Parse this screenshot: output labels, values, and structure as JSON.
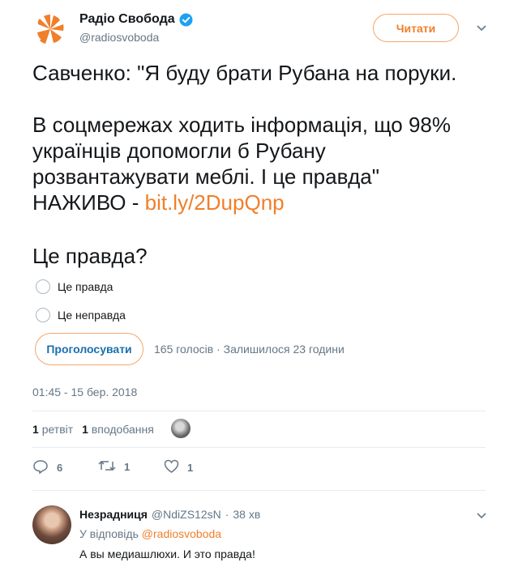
{
  "account": {
    "display_name": "Радіо Свобода",
    "handle": "@radiosvoboda",
    "follow_label": "Читати",
    "brand_color": "#f07f2a",
    "verified_color": "#1da1f2"
  },
  "tweet": {
    "line1": "Савченко: \"Я буду брати Рубана на поруки.",
    "line2": "В соцмережах ходить інформація, що 98%",
    "line3": "українців допомогли б Рубану",
    "line4": "розвантажувати меблі. І це правда\"",
    "line5_prefix": "НАЖИВО - ",
    "link": "bit.ly/2DupQnp"
  },
  "poll": {
    "question": "Це правда?",
    "options": [
      "Це правда",
      "Це неправда"
    ],
    "vote_label": "Проголосувати",
    "meta": "165 голосів · Залишилося 23 години"
  },
  "timestamp": "01:45 - 15 бер. 2018",
  "stats": {
    "retweets_count": "1",
    "retweets_label": "ретвіт",
    "likes_count": "1",
    "likes_label": "вподобання"
  },
  "actions": {
    "reply_count": "6",
    "retweet_count": "1",
    "like_count": "1"
  },
  "reply": {
    "name": "Незрадниця",
    "handle": "@NdiZS12sN",
    "separator": "·",
    "time": "38 хв",
    "reply_to_prefix": "У відповідь",
    "reply_to_mention": "@radiosvoboda",
    "text": "А вы медиашлюхи. И это правда!"
  }
}
